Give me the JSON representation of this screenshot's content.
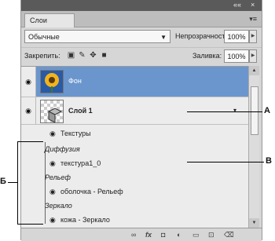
{
  "panel": {
    "collapse_label": "««",
    "close_label": "×",
    "tab_label": "Слои",
    "blend_mode": "Обычные",
    "opacity_label": "Непрозрачность:",
    "opacity_value": "100%",
    "lock_label": "Закрепить:",
    "fill_label": "Заливка:",
    "fill_value": "100%"
  },
  "layers": [
    {
      "name": "Фон",
      "selected": true
    },
    {
      "name": "Слой 1",
      "selected": false
    }
  ],
  "effects_group": "Текстуры",
  "effects": [
    {
      "category": "Диффузия",
      "texture": "текстура1_0"
    },
    {
      "category": "Рельеф",
      "texture": "оболочка - Рельеф"
    },
    {
      "category": "Зеркало",
      "texture": "кожа - Зеркало"
    }
  ],
  "callouts": {
    "a": "А",
    "b": "В",
    "c": "Б"
  },
  "colors": {
    "selection": "#6b96cd",
    "panel_bg": "#d6d6d6"
  }
}
